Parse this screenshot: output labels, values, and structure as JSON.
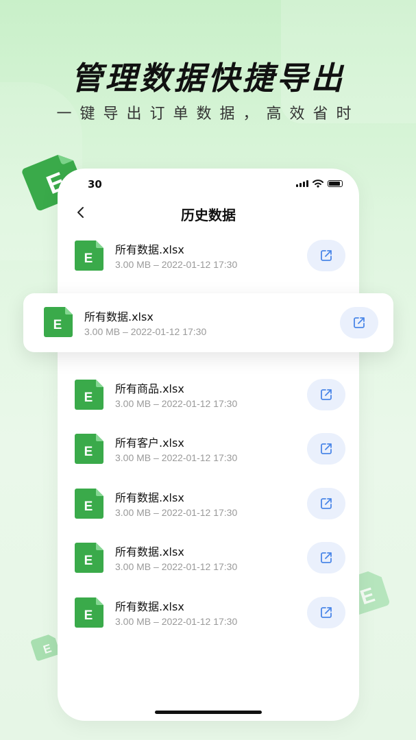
{
  "hero": {
    "title": "管理数据快捷导出",
    "subtitle": "一键导出订单数据，高效省时"
  },
  "status_bar": {
    "time": "30"
  },
  "nav": {
    "title": "历史数据"
  },
  "icon_letter": "E",
  "colors": {
    "brand_green": "#3aaa4a",
    "export_bg": "#eaf0fc",
    "export_icon": "#4a86e8"
  },
  "files": [
    {
      "name": "所有数据.xlsx",
      "meta": "3.00 MB – 2022-01-12 17:30"
    },
    {
      "name": "所有数据.xlsx",
      "meta": "3.00 MB – 2022-01-12 17:30"
    },
    {
      "name": "所有商品.xlsx",
      "meta": "3.00 MB – 2022-01-12 17:30"
    },
    {
      "name": "所有客户.xlsx",
      "meta": "3.00 MB – 2022-01-12 17:30"
    },
    {
      "name": "所有数据.xlsx",
      "meta": "3.00 MB – 2022-01-12 17:30"
    },
    {
      "name": "所有数据.xlsx",
      "meta": "3.00 MB – 2022-01-12 17:30"
    },
    {
      "name": "所有数据.xlsx",
      "meta": "3.00 MB – 2022-01-12 17:30"
    }
  ]
}
